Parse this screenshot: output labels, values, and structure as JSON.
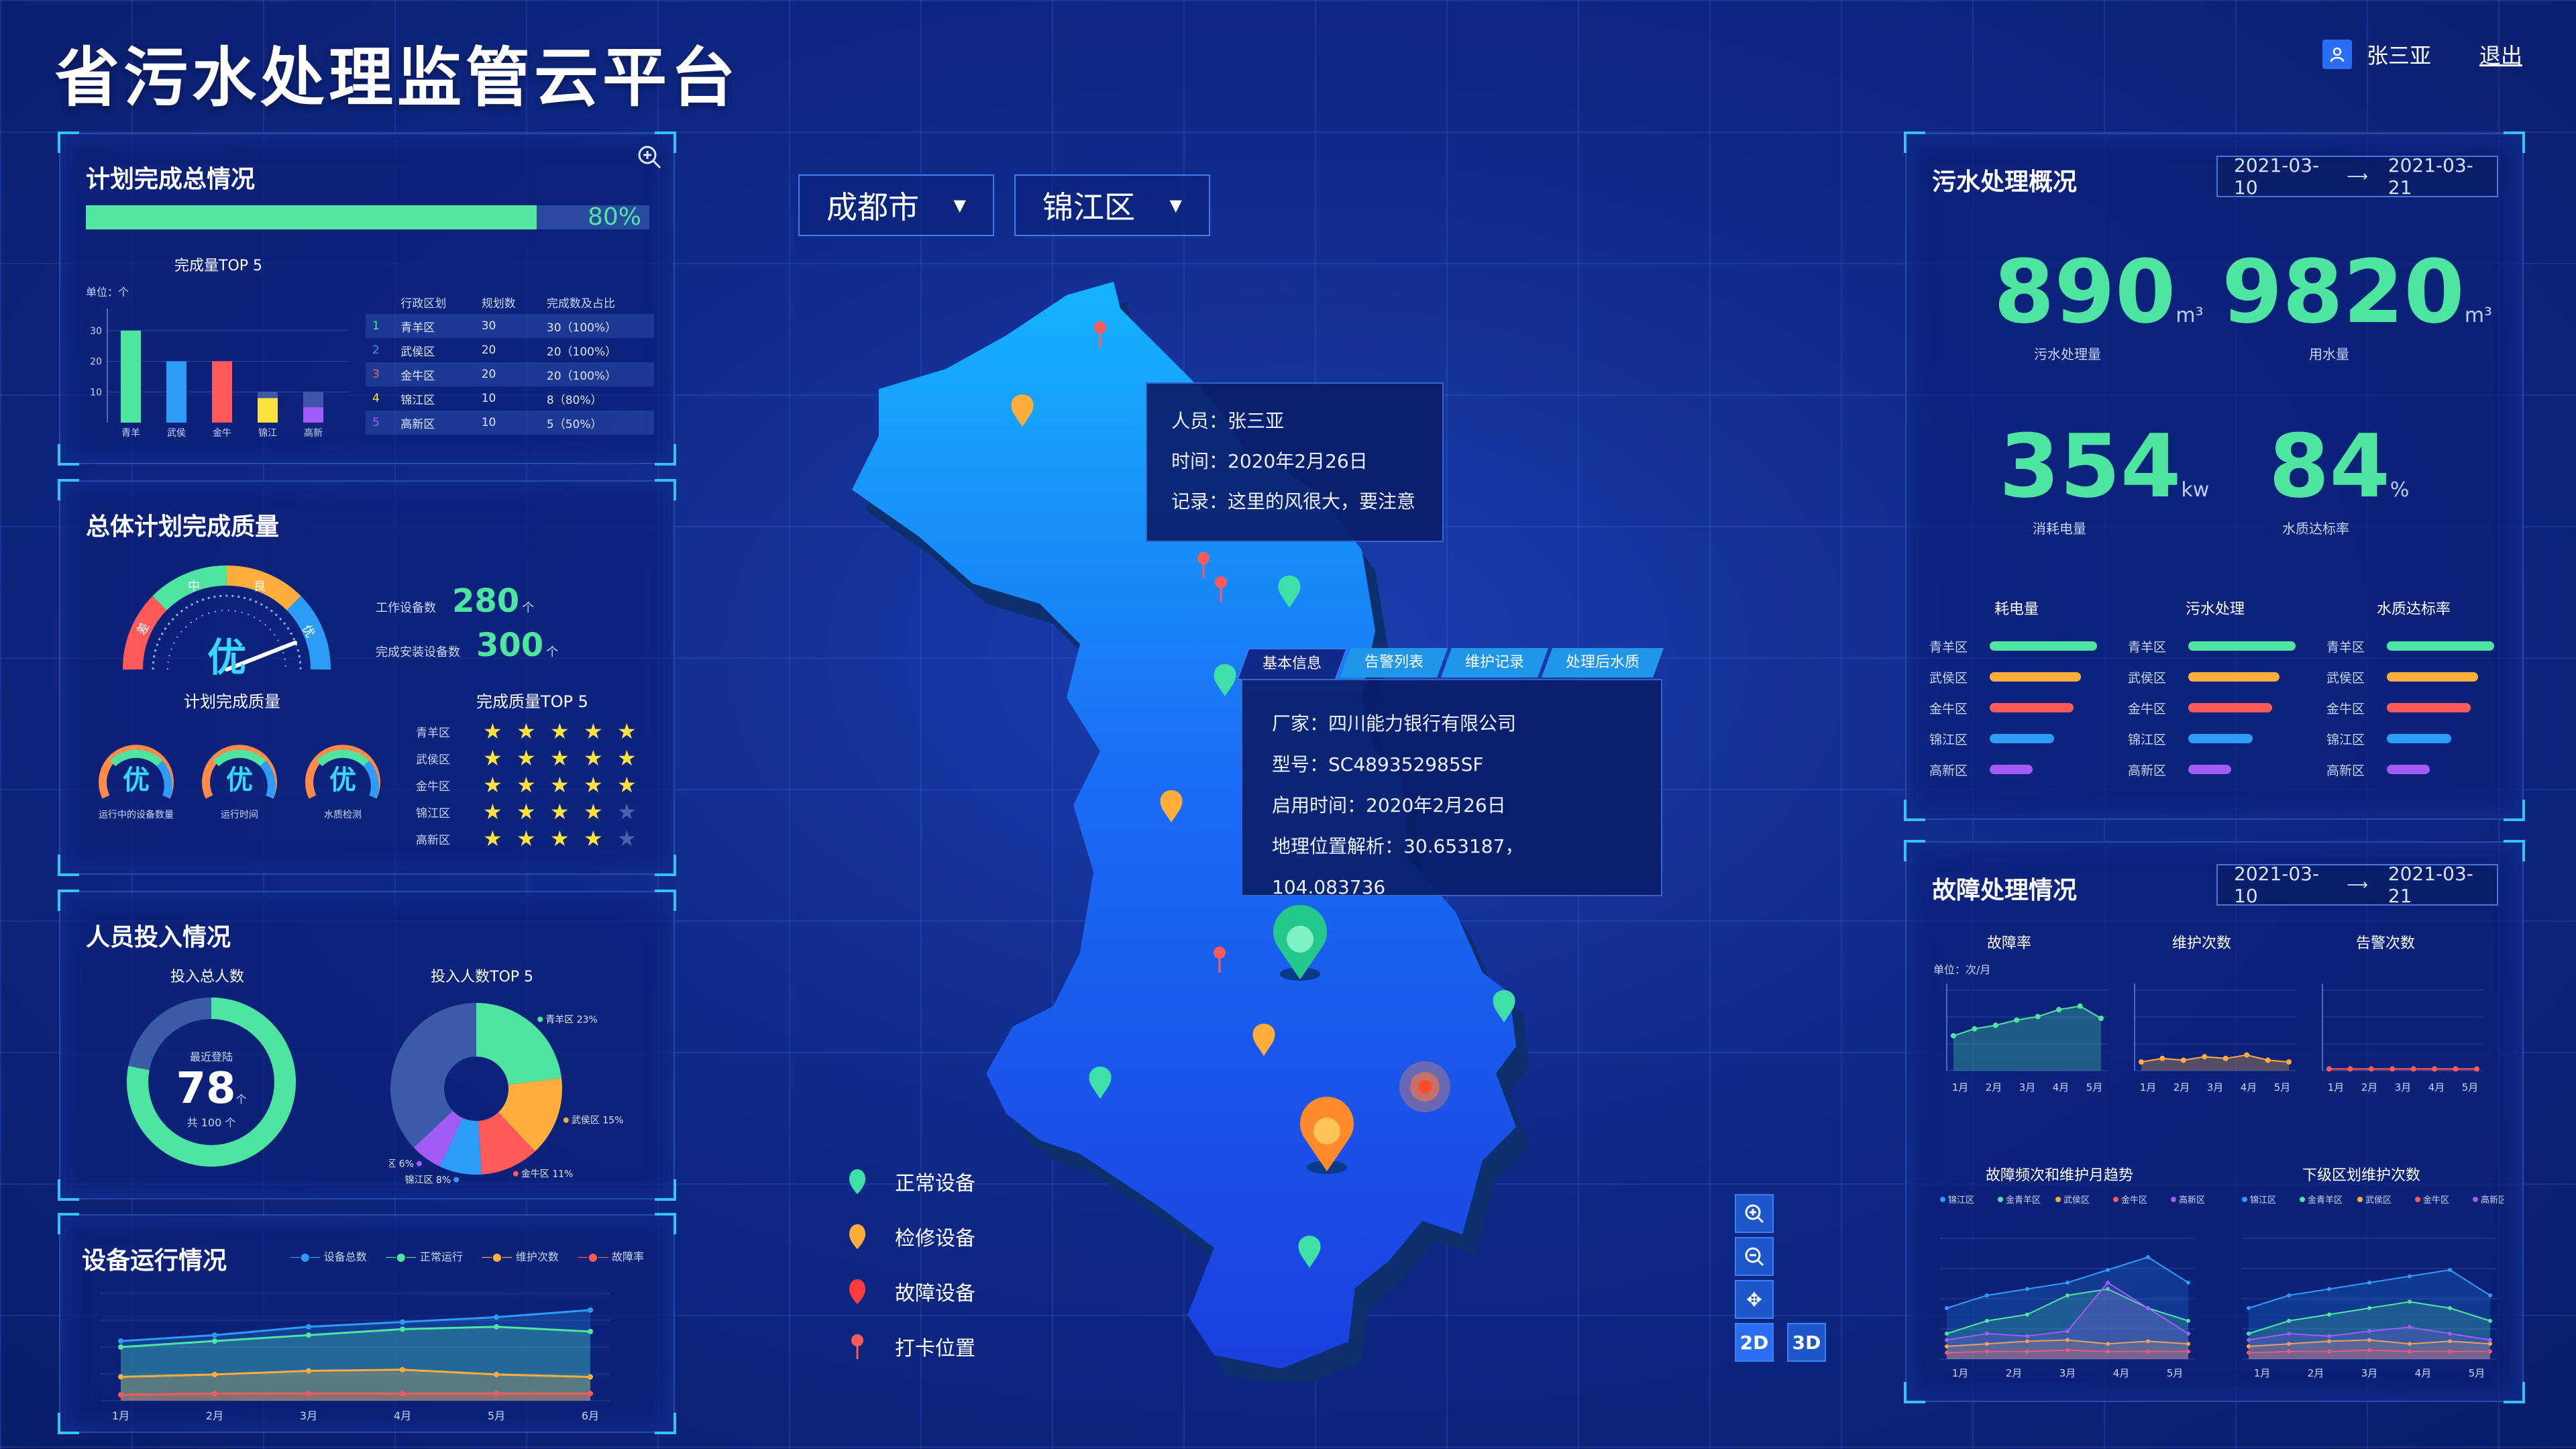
{
  "app": {
    "title": "省污水处理监管云平台"
  },
  "user": {
    "name": "张三亚",
    "logout": "退出"
  },
  "colors": {
    "green": "#4ee5a0",
    "orange": "#ffae3b",
    "red": "#ff5a5a",
    "blue": "#2d9cf7",
    "purple": "#a15cf5",
    "yellow": "#ffe140"
  },
  "plan": {
    "title": "计划完成总情况",
    "progress_pct": 80,
    "progress_label": "80%",
    "top5_title": "完成量TOP 5",
    "unit": "单位：个",
    "table_headers": [
      "行政区划",
      "规划数",
      "完成数及占比"
    ],
    "rows": [
      {
        "rank": "1",
        "name": "青羊区",
        "plan": "30",
        "done": "30（100%）"
      },
      {
        "rank": "2",
        "name": "武侯区",
        "plan": "20",
        "done": "20（100%）"
      },
      {
        "rank": "3",
        "name": "金牛区",
        "plan": "20",
        "done": "20（100%）"
      },
      {
        "rank": "4",
        "name": "锦江区",
        "plan": "10",
        "done": "8（80%）"
      },
      {
        "rank": "5",
        "name": "高新区",
        "plan": "10",
        "done": "5（50%）"
      }
    ],
    "chart_data": {
      "type": "bar",
      "categories": [
        "青羊",
        "武侯",
        "金牛",
        "锦江",
        "高新"
      ],
      "series": [
        {
          "values": [
            30,
            20,
            20,
            8,
            5
          ]
        },
        {
          "values": [
            30,
            20,
            20,
            10,
            10
          ]
        }
      ],
      "ylim": [
        0,
        35
      ],
      "yticks": [
        "30",
        "20",
        "10"
      ]
    }
  },
  "quality": {
    "title": "总体计划完成质量",
    "gauge_value": "优",
    "gauge_segments": [
      "差",
      "中",
      "良",
      "优"
    ],
    "working_label": "工作设备数",
    "working_value": "280",
    "working_unit": "个",
    "installed_label": "完成安装设备数",
    "installed_value": "300",
    "installed_unit": "个",
    "sub_title": "计划完成质量",
    "mini_gauges": [
      {
        "value": "优",
        "label": "运行中的设备数量"
      },
      {
        "value": "优",
        "label": "运行时间"
      },
      {
        "value": "优",
        "label": "水质检测"
      }
    ],
    "stars_title": "完成质量TOP 5",
    "stars": [
      {
        "name": "青羊区",
        "rating": 5
      },
      {
        "name": "武侯区",
        "rating": 5
      },
      {
        "name": "金牛区",
        "rating": 5
      },
      {
        "name": "锦江区",
        "rating": 4
      },
      {
        "name": "高新区",
        "rating": 4
      }
    ]
  },
  "staff": {
    "title": "人员投入情况",
    "total_title": "投入总人数",
    "ring_label": "最近登陆",
    "ring_value": "78",
    "ring_unit": "个",
    "ring_total": "共 100 个",
    "ring_fraction": 0.78,
    "top5_title": "投入人数TOP 5",
    "chart_data": {
      "type": "pie",
      "slices": [
        {
          "name": "青羊区",
          "value": 23,
          "label": "青羊区 23%"
        },
        {
          "name": "武侯区",
          "value": 15,
          "label": "武侯区 15%"
        },
        {
          "name": "金牛区",
          "value": 11,
          "label": "金牛区 11%"
        },
        {
          "name": "锦江区",
          "value": 8,
          "label": "锦江区 8%"
        },
        {
          "name": "高新区",
          "value": 6,
          "label": "高新区 6%"
        }
      ]
    }
  },
  "device": {
    "title": "设备运行情况",
    "legend": [
      "设备总数",
      "正常运行",
      "维护次数",
      "故障率"
    ],
    "chart_data": {
      "type": "line",
      "x": [
        "1月",
        "2月",
        "3月",
        "4月",
        "5月",
        "6月"
      ],
      "series": [
        {
          "name": "设备总数",
          "values": [
            50,
            55,
            62,
            66,
            70,
            76
          ]
        },
        {
          "name": "正常运行",
          "values": [
            45,
            50,
            55,
            60,
            62,
            58
          ]
        },
        {
          "name": "维护次数",
          "values": [
            20,
            22,
            25,
            26,
            22,
            20
          ]
        },
        {
          "name": "故障率",
          "values": [
            5,
            6,
            6,
            6,
            6,
            6
          ]
        }
      ],
      "ylim": [
        0,
        90
      ]
    }
  },
  "map": {
    "city": "成都市",
    "district": "锦江区",
    "tooltip1": [
      "人员：张三亚",
      "时间：2020年2月26日",
      "记录：这里的风很大，要注意"
    ],
    "tabs": [
      "基本信息",
      "告警列表",
      "维护记录",
      "处理后水质"
    ],
    "info": [
      "厂家：四川能力银行有限公司",
      "型号：SC489352985SF",
      "启用时间：2020年2月26日",
      "地理位置解析：30.653187，104.083736"
    ],
    "legend": [
      {
        "label": "正常设备",
        "color": "#3fe0a8"
      },
      {
        "label": "检修设备",
        "color": "#ffae3b"
      },
      {
        "label": "故障设备",
        "color": "#ff3b3b"
      },
      {
        "label": "打卡位置",
        "color": "#ff5a5a"
      }
    ],
    "controls": {
      "zoom_in": "＋",
      "zoom_out": "－",
      "pan": "✥",
      "view_2d": "2D",
      "view_3d": "3D"
    }
  },
  "sewage": {
    "title": "污水处理概况",
    "date_from": "2021-03-10",
    "date_to": "2021-03-21",
    "stats": [
      {
        "value": "890",
        "unit": "m³",
        "label": "污水处理量"
      },
      {
        "value": "9820",
        "unit": "m³",
        "label": "用水量"
      },
      {
        "value": "354",
        "unit": "kw",
        "label": "消耗电量"
      },
      {
        "value": "84",
        "unit": "%",
        "label": "水质达标率"
      }
    ],
    "bars": [
      {
        "title": "耗电量",
        "items": [
          {
            "name": "青羊区",
            "v": 1.0
          },
          {
            "name": "武侯区",
            "v": 0.85
          },
          {
            "name": "金牛区",
            "v": 0.78
          },
          {
            "name": "锦江区",
            "v": 0.6
          },
          {
            "name": "高新区",
            "v": 0.4
          }
        ]
      },
      {
        "title": "污水处理",
        "items": [
          {
            "name": "青羊区",
            "v": 1.0
          },
          {
            "name": "武侯区",
            "v": 0.85
          },
          {
            "name": "金牛区",
            "v": 0.78
          },
          {
            "name": "锦江区",
            "v": 0.6
          },
          {
            "name": "高新区",
            "v": 0.4
          }
        ]
      },
      {
        "title": "水质达标率",
        "items": [
          {
            "name": "青羊区",
            "v": 1.0
          },
          {
            "name": "武侯区",
            "v": 0.85
          },
          {
            "name": "金牛区",
            "v": 0.78
          },
          {
            "name": "锦江区",
            "v": 0.6
          },
          {
            "name": "高新区",
            "v": 0.4
          }
        ]
      }
    ]
  },
  "fault": {
    "title": "故障处理情况",
    "date_from": "2021-03-10",
    "date_to": "2021-03-21",
    "unit": "单位：次/月",
    "mini_titles": [
      "故障率",
      "维护次数",
      "告警次数"
    ],
    "months": [
      "1月",
      "2月",
      "3月",
      "4月",
      "5月"
    ],
    "mini_series": [
      {
        "values": [
          40,
          48,
          52,
          58,
          62,
          70,
          74,
          60
        ]
      },
      {
        "values": [
          10,
          14,
          12,
          16,
          14,
          18,
          12,
          10
        ]
      },
      {
        "values": [
          2,
          2,
          2,
          2,
          2,
          2,
          2,
          2
        ]
      }
    ],
    "trend_title": "故障频次和维护月趋势",
    "district_title": "下级区划维护次数",
    "legend": [
      "锦江区",
      "金青羊区",
      "武侯区",
      "金牛区",
      "高新区"
    ]
  }
}
